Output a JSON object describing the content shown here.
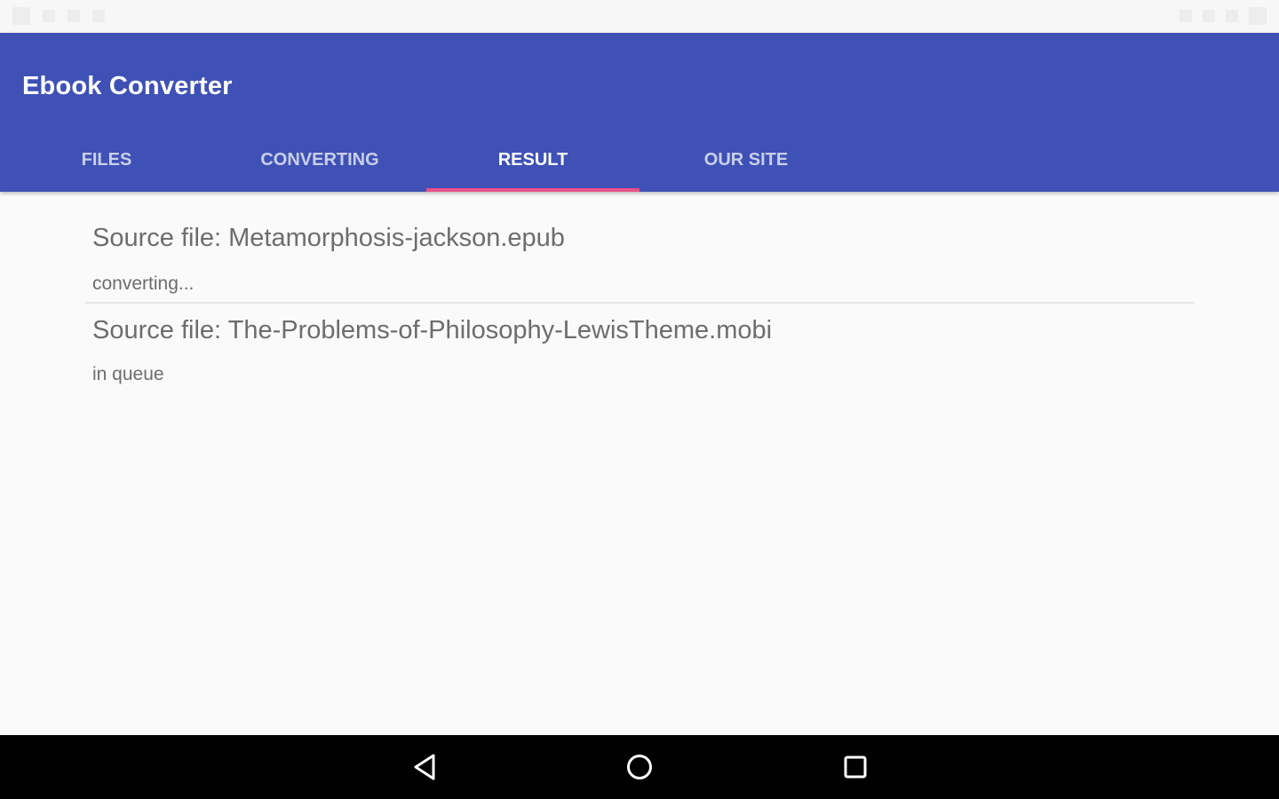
{
  "app": {
    "title": "Ebook Converter"
  },
  "tabs": [
    {
      "label": "FILES",
      "active": false
    },
    {
      "label": "CONVERTING",
      "active": false
    },
    {
      "label": "RESULT",
      "active": true
    },
    {
      "label": "OUR SITE",
      "active": false
    }
  ],
  "results": [
    {
      "source": "Source file: Metamorphosis-jackson.epub",
      "status": "converting..."
    },
    {
      "source": "Source file: The-Problems-of-Philosophy-LewisTheme.mobi",
      "status": "in queue"
    }
  ],
  "navigation": {
    "icons": [
      "back-icon",
      "home-icon",
      "recents-icon"
    ]
  },
  "colors": {
    "primary": "#3f51b5",
    "accent": "#e94f87",
    "background": "#fafafa",
    "text_secondary": "#6d6d6d"
  }
}
